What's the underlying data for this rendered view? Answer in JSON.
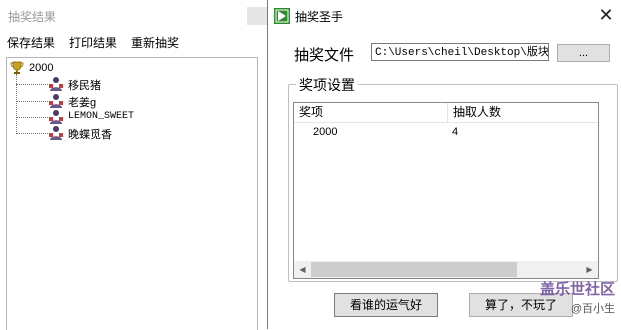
{
  "results_window": {
    "title": "抽奖结果",
    "menu": [
      "保存结果",
      "打印结果",
      "重新抽奖"
    ],
    "tree": {
      "root_label": "2000",
      "root_icon": "trophy-icon",
      "items": [
        "移民猪",
        "老姜g",
        "LEMON_SWEET",
        "晚蝶觅香"
      ],
      "item_icon": "user-icon"
    }
  },
  "dialog": {
    "title": "抽奖圣手",
    "app_icon": "app-icon",
    "close_glyph": "✕",
    "file_label": "抽奖文件",
    "file_path": "C:\\Users\\cheil\\Desktop\\版块活",
    "browse_label": "...",
    "group_title": "奖项设置",
    "columns": [
      "奖项",
      "抽取人数"
    ],
    "rows": [
      {
        "prize": "2000",
        "count": "4"
      }
    ],
    "luck_button": "看谁的运气好",
    "quit_button": "算了，不玩了"
  },
  "watermark": {
    "line1": "盖乐世社区",
    "line2": "@百小生"
  },
  "colors": {
    "border": "#7a7a7a",
    "button_bg": "#e1e1e1",
    "user_icon": "#4a3a6a",
    "trophy": "#c8a21a"
  }
}
